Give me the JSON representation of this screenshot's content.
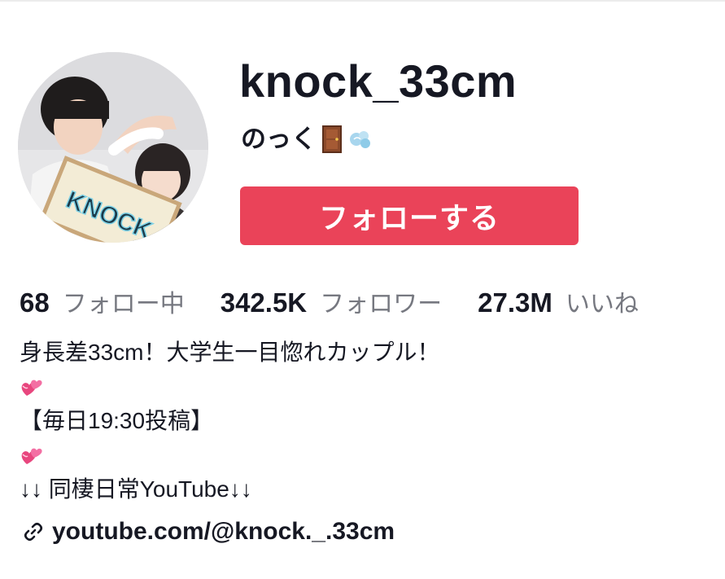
{
  "profile": {
    "username": "knock_33cm",
    "display_name": "のっく",
    "follow_button_label": "フォローする"
  },
  "stats": [
    {
      "value": "68",
      "label": "フォロー中"
    },
    {
      "value": "342.5K",
      "label": "フォロワー"
    },
    {
      "value": "27.3M",
      "label": "いいね"
    }
  ],
  "bio": {
    "line1": "身長差33cm！大学生一目惚れカップル！",
    "line3": "【毎日19:30投稿】",
    "line5": "↓↓ 同棲日常YouTube↓↓"
  },
  "link": {
    "text": "youtube.com/@knock._.33cm"
  },
  "avatar_sign_text": "KNOCK",
  "icons": {
    "door": "door-emoji",
    "dash": "dash-emoji",
    "hearts": "two-hearts-emoji",
    "link": "link-icon"
  },
  "colors": {
    "accent": "#ea4359",
    "text": "#161823",
    "muted": "#767880"
  }
}
